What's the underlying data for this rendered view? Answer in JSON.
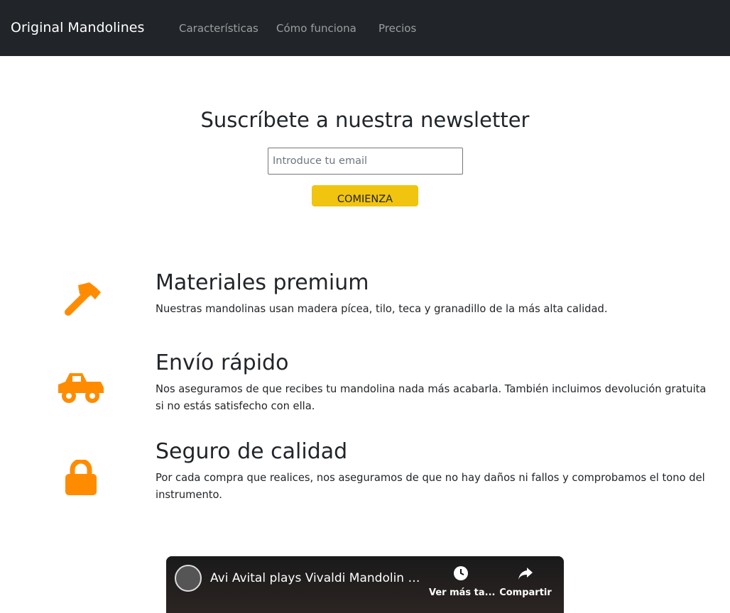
{
  "navbar": {
    "brand": "Original Mandolines",
    "links": [
      "Características",
      "Cómo funciona",
      "Precios"
    ]
  },
  "newsletter": {
    "title": "Suscríbete a nuestra newsletter",
    "email_placeholder": "Introduce tu email",
    "email_value": "",
    "button_label": "COMIENZA"
  },
  "features": [
    {
      "icon": "hammer-icon",
      "heading": "Materiales premium",
      "text": "Nuestras mandolinas usan madera pícea, tilo, teca y granadillo de la más alta calidad."
    },
    {
      "icon": "truck-icon",
      "heading": "Envío rápido",
      "text": "Nos aseguramos de que recibes tu mandolina nada más acabarla. También incluimos devolución gratuita si no estás satisfecho con ella."
    },
    {
      "icon": "lock-icon",
      "heading": "Seguro de calidad",
      "text": "Por cada compra que realices, nos aseguramos de que no hay daños ni fallos y comprobamos el tono del instrumento."
    }
  ],
  "video": {
    "title": "Avi Avital plays Vivaldi Mandolin Co...",
    "watch_later_label": "Ver más ta...",
    "share_label": "Compartir"
  },
  "colors": {
    "navbar_bg": "#212529",
    "accent_button": "#f1c40f",
    "icon_color": "#ff8c00"
  }
}
